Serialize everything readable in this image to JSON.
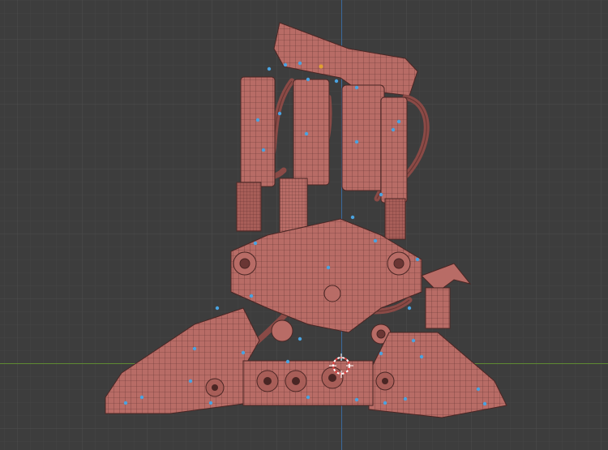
{
  "viewport": {
    "background_color": "#3d3d3d",
    "grid_minor_color": "#444444",
    "grid_major_color": "#4c4c4c",
    "x_axis_color": "#5e8a33",
    "y_axis_color": "#3a6a9c"
  },
  "model": {
    "base_color": "#b86c66",
    "shade_color": "#8a4a46",
    "wire_color": "#4a2624",
    "vertex_color": "#4aa3e0",
    "selected_vertex_color": "#e0a030"
  },
  "cursor": {
    "icon": "3d-cursor-icon",
    "ring_color": "#e04040",
    "ring_alt_color": "#ffffff"
  }
}
